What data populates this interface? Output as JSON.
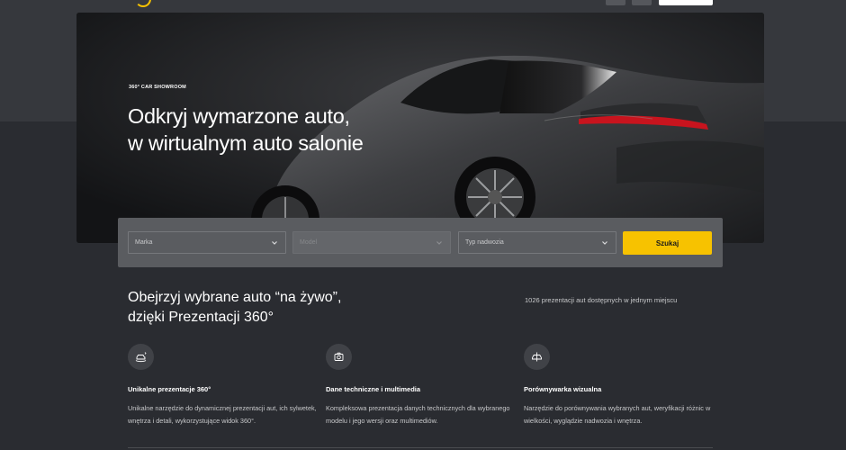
{
  "hero": {
    "eyebrow": "360° CAR SHOWROOM",
    "title_line1": "Odkryj wymarzone auto,",
    "title_line2": "w wirtualnym auto salonie"
  },
  "search": {
    "brand_placeholder": "Marka",
    "model_placeholder": "Model",
    "body_type_placeholder": "Typ nadwozia",
    "submit_label": "Szukaj"
  },
  "section": {
    "title_line1": "Obejrzyj wybrane auto “na żywo”,",
    "title_line2": "dzięki Prezentacji 360°",
    "count_text": "1026 prezentacji aut dostępnych w jednym miejscu"
  },
  "features": [
    {
      "icon": "car-360-icon",
      "title": "Unikalne prezentacje 360°",
      "description": "Unikalne narzędzie do dynamicznej prezentacji aut, ich sylwetek, wnętrza i detali, wykorzystujące widok 360°."
    },
    {
      "icon": "camera-icon",
      "title": "Dane techniczne i multimedia",
      "description": "Kompleksowa prezentacja danych technicznych dla wybranego modelu i jego wersji oraz multimediów."
    },
    {
      "icon": "car-compare-icon",
      "title": "Porównywarka wizualna",
      "description": "Narzędzie do porównywania wybranych aut, weryfikacji różnic w wielkości, wyglądzie nadwozia i wnętrza."
    }
  ],
  "colors": {
    "accent": "#f7c200",
    "background": "#2a2c31",
    "searchbar": "#5a5c60"
  }
}
